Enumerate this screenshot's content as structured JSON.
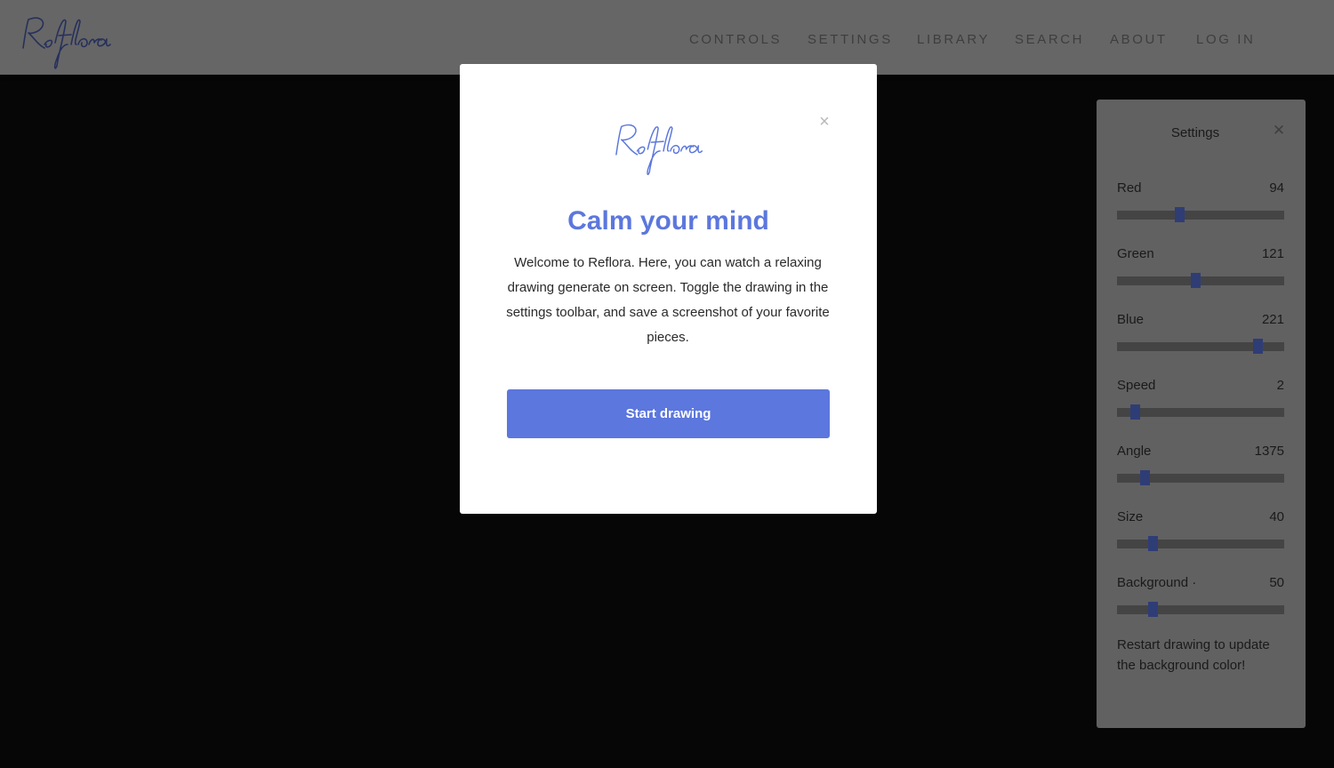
{
  "brand": {
    "name": "Reflora",
    "logo_color": "#4d5aa3"
  },
  "nav": [
    {
      "label": "CONTROLS"
    },
    {
      "label": "SETTINGS"
    },
    {
      "label": "LIBRARY"
    },
    {
      "label": "SEARCH"
    },
    {
      "label": "ABOUT"
    },
    {
      "label": "LOG IN"
    }
  ],
  "modal": {
    "logo": "Reflora",
    "close_icon": "close-icon",
    "title": "Calm your mind",
    "body": "Welcome to Reflora. Here, you can watch a relaxing drawing generate on screen. Toggle the drawing in the settings toolbar, and save a screenshot of your favorite pieces.",
    "button_label": "Start drawing",
    "accent_color": "#5c77dd"
  },
  "settings": {
    "title": "Settings",
    "close_icon": "close-icon",
    "sliders": [
      {
        "label": "Red",
        "value": "94",
        "level": 0.37
      },
      {
        "label": "Green",
        "value": "121",
        "level": 0.47
      },
      {
        "label": "Blue",
        "value": "221",
        "level": 0.84
      },
      {
        "label": "Speed",
        "value": "2",
        "level": 0.105
      },
      {
        "label": "Angle",
        "value": "1375",
        "level": 0.165
      },
      {
        "label": "Size",
        "value": "40",
        "level": 0.215
      },
      {
        "label": "Background ·",
        "value": "50",
        "level": 0.215
      }
    ],
    "note": "Restart drawing to update the background color!"
  }
}
